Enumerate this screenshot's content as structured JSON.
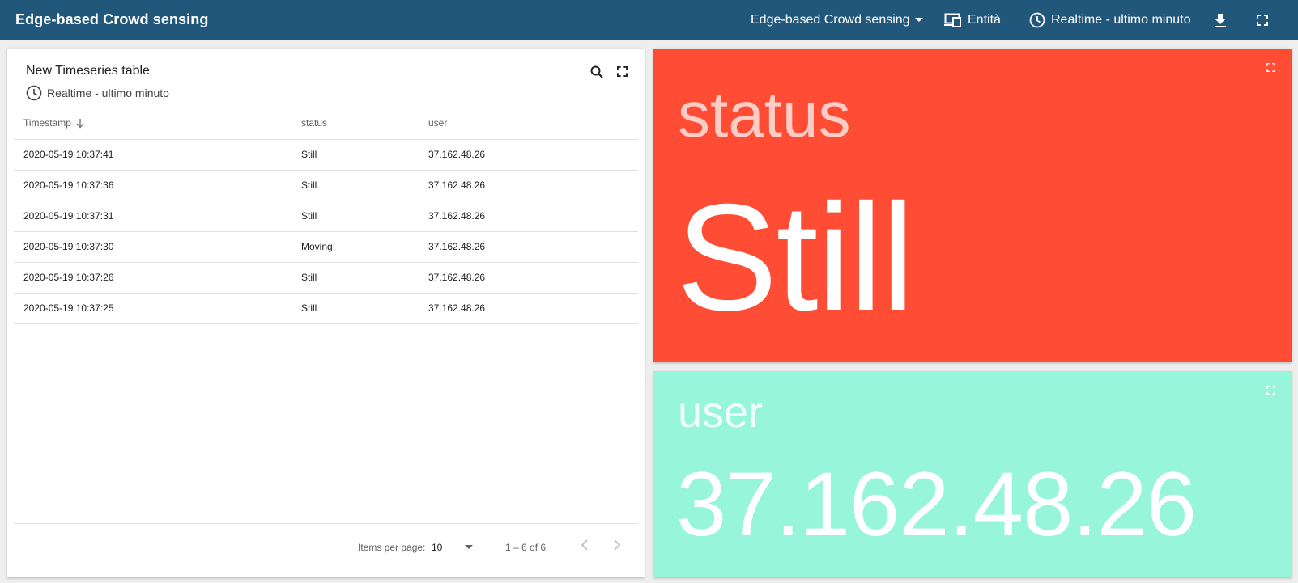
{
  "toolbar": {
    "title": "Edge-based Crowd sensing",
    "dashboard_selected": "Edge-based Crowd sensing",
    "entities_label": "Entità",
    "timewindow_label": "Realtime - ultimo minuto",
    "background": "#22577c"
  },
  "table_widget": {
    "title": "New Timeseries table",
    "timewindow": "Realtime - ultimo minuto",
    "columns": [
      "Timestamp",
      "status",
      "user"
    ],
    "rows": [
      [
        "2020-05-19 10:37:41",
        "Still",
        "37.162.48.26"
      ],
      [
        "2020-05-19 10:37:36",
        "Still",
        "37.162.48.26"
      ],
      [
        "2020-05-19 10:37:31",
        "Still",
        "37.162.48.26"
      ],
      [
        "2020-05-19 10:37:30",
        "Moving",
        "37.162.48.26"
      ],
      [
        "2020-05-19 10:37:26",
        "Still",
        "37.162.48.26"
      ],
      [
        "2020-05-19 10:37:25",
        "Still",
        "37.162.48.26"
      ]
    ],
    "paginator": {
      "items_per_page_label": "Items per page:",
      "items_per_page": "10",
      "range": "1 – 6 of 6"
    }
  },
  "status_card": {
    "label": "status",
    "value": "Still",
    "color": "#ff4c35"
  },
  "user_card": {
    "label": "user",
    "value": "37.162.48.26",
    "color": "#97f5d9"
  },
  "icons": {
    "toolbar": [
      "caret-down-icon",
      "devices-icon",
      "clock-icon",
      "download-icon",
      "fullscreen-icon"
    ],
    "table": [
      "clock-icon",
      "search-icon",
      "fullscreen-icon",
      "arrow-down-icon",
      "caret-down-icon",
      "chevron-left-icon",
      "chevron-right-icon"
    ]
  }
}
